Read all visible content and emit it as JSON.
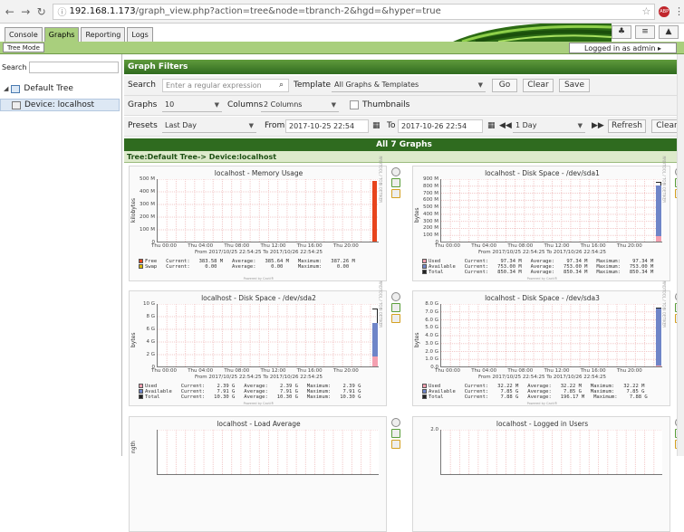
{
  "browser": {
    "host": "192.168.1.173",
    "path": "/graph_view.php?action=tree&node=tbranch-2&hgd=&hyper=true",
    "ext_badge": "ABP"
  },
  "tabs": [
    {
      "label": "Console"
    },
    {
      "label": "Graphs"
    },
    {
      "label": "Reporting"
    },
    {
      "label": "Logs"
    }
  ],
  "navbar": {
    "tree_mode": "Tree Mode",
    "logged_in": "Logged in as admin ▸"
  },
  "sidebar": {
    "search_label": "Search",
    "tree_root": "Default Tree",
    "device": "Device: localhost"
  },
  "filters": {
    "title": "Graph Filters",
    "search_label": "Search",
    "search_placeholder": "Enter a regular expression",
    "template_label": "Template",
    "template_value": "All Graphs & Templates",
    "go": "Go",
    "clear": "Clear",
    "save": "Save",
    "graphs_label": "Graphs",
    "graphs_value": "10",
    "columns_label": "Columns",
    "columns_value": "2 Columns",
    "thumbnails_label": "Thumbnails",
    "presets_label": "Presets",
    "presets_value": "Last Day",
    "from_label": "From",
    "from_value": "2017-10-25 22:54",
    "to_label": "To",
    "to_value": "2017-10-26 22:54",
    "span_value": "1 Day",
    "refresh": "Refresh",
    "clear2": "Clear"
  },
  "banner": {
    "all": "All 7 Graphs",
    "crumb": "Tree:Default Tree-> Device:localhost"
  },
  "graphs": [
    {
      "title": "localhost - Memory Usage",
      "ylabel": "kilobytes",
      "yticks": [
        "500 M",
        "400 M",
        "300 M",
        "200 M",
        "100 M",
        "0"
      ],
      "period": "From 2017/10/25 22:54:25 To 2017/10/26 22:54:25",
      "legend": [
        "Free   Current:   383.58 M   Average:   385.64 M   Maximum:   387.26 M",
        "Swap   Current:     0.00     Average:     0.00     Maximum:     0.00"
      ],
      "powered": "Powered by Cacti®",
      "side": "RRDTOOL / TOBI OETIKER",
      "colors": [
        "#e8441c",
        "#d8b800"
      ]
    },
    {
      "title": "localhost - Disk Space - /dev/sda1",
      "ylabel": "bytes",
      "yticks": [
        "900 M",
        "800 M",
        "700 M",
        "600 M",
        "500 M",
        "400 M",
        "300 M",
        "200 M",
        "100 M",
        "0"
      ],
      "period": "From 2017/10/25 22:54:25 To 2017/10/26 22:54:25",
      "legend": [
        "Used        Current:    97.34 M   Average:    97.34 M   Maximum:    97.34 M",
        "Available   Current:   753.00 M   Average:   753.00 M   Maximum:   753.00 M",
        "Total       Current:   850.34 M   Average:   850.34 M   Maximum:   850.34 M"
      ],
      "powered": "Powered by Cacti®",
      "side": "RRDTOOL / TOBI OETIKER",
      "colors": [
        "#f4a0b0",
        "#6f85c8",
        "#222222"
      ]
    },
    {
      "title": "localhost - Disk Space - /dev/sda2",
      "ylabel": "bytes",
      "yticks": [
        "10 G",
        "8 G",
        "6 G",
        "4 G",
        "2 G",
        "0"
      ],
      "period": "From 2017/10/25 22:54:25 To 2017/10/26 22:54:25",
      "legend": [
        "Used        Current:    2.39 G   Average:    2.39 G   Maximum:    2.39 G",
        "Available   Current:    7.91 G   Average:    7.91 G   Maximum:    7.91 G",
        "Total       Current:   10.30 G   Average:   10.30 G   Maximum:   10.30 G"
      ],
      "powered": "Powered by Cacti®",
      "side": "RRDTOOL / TOBI OETIKER",
      "colors": [
        "#f4a0b0",
        "#6f85c8",
        "#222222"
      ]
    },
    {
      "title": "localhost - Disk Space - /dev/sda3",
      "ylabel": "bytes",
      "yticks": [
        "8.0 G",
        "7.0 G",
        "6.0 G",
        "5.0 G",
        "4.0 G",
        "3.0 G",
        "2.0 G",
        "1.0 G",
        "0.0"
      ],
      "period": "From 2017/10/25 22:54:25 To 2017/10/26 22:54:25",
      "legend": [
        "Used        Current:   32.22 M   Average:   32.22 M   Maximum:   32.22 M",
        "Available   Current:    7.85 G   Average:    7.85 G   Maximum:    7.85 G",
        "Total       Current:    7.88 G   Average:   196.17 M   Maximum:    7.88 G"
      ],
      "powered": "Powered by Cacti®",
      "side": "RRDTOOL / TOBI OETIKER",
      "colors": [
        "#f4a0b0",
        "#6f85c8",
        "#222222"
      ]
    },
    {
      "title": "localhost - Load Average",
      "ylabel": "ngth",
      "yticks": []
    },
    {
      "title": "localhost - Logged in Users",
      "ylabel": "",
      "yticks": [
        "2.0"
      ]
    }
  ],
  "xticks": [
    "Thu 00:00",
    "Thu 04:00",
    "Thu 08:00",
    "Thu 12:00",
    "Thu 16:00",
    "Thu 20:00"
  ]
}
